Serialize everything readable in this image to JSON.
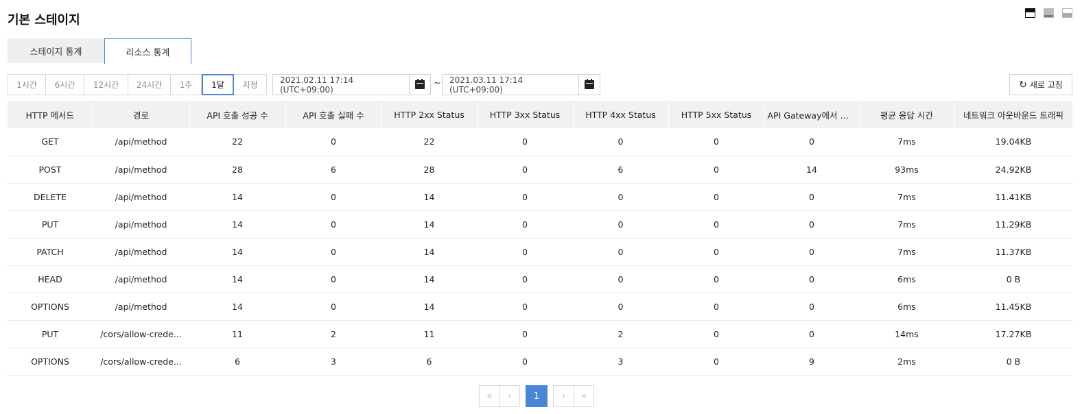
{
  "page": {
    "title": "기본 스테이지"
  },
  "tabs": [
    {
      "label": "스테이지 통계",
      "active": false
    },
    {
      "label": "리소스 통계",
      "active": true
    }
  ],
  "ranges": [
    {
      "label": "1시간",
      "active": false
    },
    {
      "label": "6시간",
      "active": false
    },
    {
      "label": "12시간",
      "active": false
    },
    {
      "label": "24시간",
      "active": false
    },
    {
      "label": "1주",
      "active": false
    },
    {
      "label": "1달",
      "active": true
    },
    {
      "label": "지정",
      "active": false
    }
  ],
  "date_range": {
    "start": "2021.02.11 17:14 (UTC+09:00)",
    "separator": "~",
    "end": "2021.03.11 17:14 (UTC+09:00)"
  },
  "toolbar": {
    "refresh_label": "새로 고침"
  },
  "table": {
    "columns": [
      "HTTP 메서드",
      "경로",
      "API 호출 성공 수",
      "API 호출 실패 수",
      "HTTP 2xx Status",
      "HTTP 3xx Status",
      "HTTP 4xx Status",
      "HTTP 5xx Status",
      "API Gateway에서 바로...",
      "평균 응답 시간",
      "네트워크 아웃바운드 트래픽"
    ],
    "rows": [
      [
        "GET",
        "/api/method",
        "22",
        "0",
        "22",
        "0",
        "0",
        "0",
        "0",
        "7ms",
        "19.04KB"
      ],
      [
        "POST",
        "/api/method",
        "28",
        "6",
        "28",
        "0",
        "6",
        "0",
        "14",
        "93ms",
        "24.92KB"
      ],
      [
        "DELETE",
        "/api/method",
        "14",
        "0",
        "14",
        "0",
        "0",
        "0",
        "0",
        "7ms",
        "11.41KB"
      ],
      [
        "PUT",
        "/api/method",
        "14",
        "0",
        "14",
        "0",
        "0",
        "0",
        "0",
        "7ms",
        "11.29KB"
      ],
      [
        "PATCH",
        "/api/method",
        "14",
        "0",
        "14",
        "0",
        "0",
        "0",
        "0",
        "7ms",
        "11.37KB"
      ],
      [
        "HEAD",
        "/api/method",
        "14",
        "0",
        "14",
        "0",
        "0",
        "0",
        "0",
        "6ms",
        "0 B"
      ],
      [
        "OPTIONS",
        "/api/method",
        "14",
        "0",
        "14",
        "0",
        "0",
        "0",
        "0",
        "6ms",
        "11.45KB"
      ],
      [
        "PUT",
        "/cors/allow-crede...",
        "11",
        "2",
        "11",
        "0",
        "2",
        "0",
        "0",
        "14ms",
        "17.27KB"
      ],
      [
        "OPTIONS",
        "/cors/allow-crede...",
        "6",
        "3",
        "6",
        "0",
        "3",
        "0",
        "9",
        "2ms",
        "0 B"
      ]
    ]
  },
  "pagination": {
    "first": "«",
    "prev": "‹",
    "current_page": "1",
    "next": "›",
    "last": "»"
  },
  "colors": {
    "accent": "#4a86d8",
    "header_bg": "#f1f1f1",
    "tab_bg": "#efefef"
  }
}
